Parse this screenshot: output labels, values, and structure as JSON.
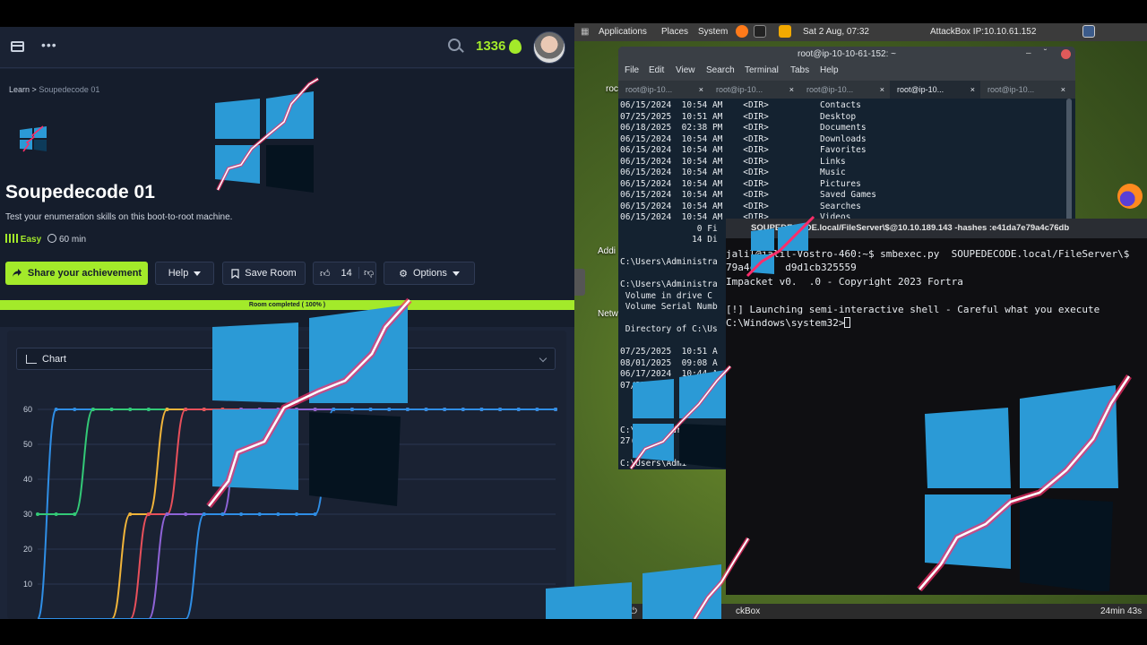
{
  "site": {
    "points": "1336",
    "breadcrumb": {
      "root": "Learn",
      "sep": ">",
      "current": "Soupedecode 01"
    },
    "room": {
      "title": "Soupedecode 01",
      "subtitle": "Test your enumeration skills on this boot-to-root machine.",
      "difficulty": "Easy",
      "duration": "60 min"
    },
    "buttons": {
      "share": "Share your achievement",
      "help": "Help",
      "save": "Save Room",
      "likes": "14",
      "options": "Options"
    },
    "progress_label": "Room completed ( 100% )",
    "progress_value": 100,
    "chart_select": "Chart"
  },
  "chart_data": {
    "type": "line",
    "y_ticks": [
      "60",
      "50",
      "40",
      "30",
      "20",
      "10"
    ],
    "ylim": [
      0,
      60
    ],
    "grid": true,
    "colors": [
      "#2f8ee5",
      "#33c977",
      "#f0b43a",
      "#e8505b",
      "#8e63d6"
    ],
    "series": [
      {
        "color": "#2f8ee5",
        "values": [
          0,
          60,
          60,
          60,
          60,
          60,
          60,
          60,
          60,
          60,
          60,
          60,
          60,
          60,
          60,
          60,
          60,
          60,
          60,
          60,
          60,
          60,
          60,
          60,
          60,
          60,
          60,
          60,
          60
        ]
      },
      {
        "color": "#33c977",
        "values": [
          30,
          30,
          30,
          60,
          60,
          60,
          60,
          60,
          60,
          60,
          60,
          60,
          60,
          60,
          60,
          60,
          60,
          60,
          60,
          60,
          60,
          60,
          60,
          60,
          60,
          60,
          60,
          60,
          60
        ]
      },
      {
        "color": "#f0b43a",
        "values": [
          0,
          0,
          0,
          0,
          0,
          30,
          30,
          60,
          60,
          60,
          60,
          60,
          60,
          60,
          60,
          60,
          60,
          60,
          60,
          60,
          60,
          60,
          60,
          60,
          60,
          60,
          60,
          60,
          60
        ]
      },
      {
        "color": "#e8505b",
        "values": [
          0,
          0,
          0,
          0,
          0,
          0,
          30,
          30,
          60,
          60,
          60,
          60,
          60,
          60,
          60,
          60,
          60,
          60,
          60,
          60,
          60,
          60,
          60,
          60,
          60,
          60,
          60,
          60,
          60
        ]
      },
      {
        "color": "#8e63d6",
        "values": [
          0,
          0,
          0,
          0,
          0,
          0,
          0,
          30,
          30,
          30,
          30,
          60,
          60,
          60,
          60,
          60,
          60,
          60,
          60,
          60,
          60,
          60,
          60,
          60,
          60,
          60,
          60,
          60,
          60
        ]
      },
      {
        "color": "#2f8ee5",
        "values": [
          0,
          0,
          0,
          0,
          0,
          0,
          0,
          0,
          0,
          30,
          30,
          30,
          30,
          30,
          30,
          30,
          60,
          60,
          60,
          60,
          60,
          60,
          60,
          60,
          60,
          60,
          60,
          60,
          60
        ]
      }
    ]
  },
  "desktop": {
    "panel": {
      "applications": "Applications",
      "places": "Places",
      "system": "System",
      "datetime": "Sat 2 Aug, 07:32",
      "attackbox": "AttackBox IP:10.10.61.152"
    },
    "labels": {
      "roc": "roc",
      "addi": "Addi",
      "netw": "Netw"
    },
    "taskbar": {
      "app": "ckBox",
      "timer": "24min 43s"
    }
  },
  "terminal": {
    "title": "root@ip-10-10-61-152: ~",
    "menu": [
      "File",
      "Edit",
      "View",
      "Search",
      "Terminal",
      "Tabs",
      "Help"
    ],
    "tabs": [
      "root@ip-10...",
      "root@ip-10...",
      "root@ip-10...",
      "root@ip-10...",
      "root@ip-10..."
    ],
    "active_tab": 3,
    "lines": [
      "06/15/2024  10:54 AM    <DIR>          Contacts",
      "07/25/2025  10:51 AM    <DIR>          Desktop",
      "06/18/2025  02:38 PM    <DIR>          Documents",
      "06/15/2024  10:54 AM    <DIR>          Downloads",
      "06/15/2024  10:54 AM    <DIR>          Favorites",
      "06/15/2024  10:54 AM    <DIR>          Links",
      "06/15/2024  10:54 AM    <DIR>          Music",
      "06/15/2024  10:54 AM    <DIR>          Pictures",
      "06/15/2024  10:54 AM    <DIR>          Saved Games",
      "06/15/2024  10:54 AM    <DIR>          Searches",
      "06/15/2024  10:54 AM    <DIR>          Videos",
      "               0 Fi",
      "              14 Di",
      "",
      "C:\\Users\\Administra",
      "",
      "C:\\Users\\Administra",
      " Volume in drive C",
      " Volume Serial Numb",
      "",
      " Directory of C:\\Us",
      "",
      "07/25/2025  10:51 A",
      "08/01/2025  09:08 A",
      "06/17/2024  10:44 A",
      "07/25/2025  10:51",
      "",
      "",
      "",
      "C:\\Users\\Adr",
      "27(",
      "",
      "C:\\Users\\Admi"
    ]
  },
  "terminal2": {
    "title": "SOUPEDECODE.local/FileServer\\$@10.10.189.143 -hashes :e41da7e79a4c76db",
    "lines": [
      "jalil@jalil-Vostro-460:~$ smbexec.py  SOUPEDECODE.local/FileServer\\$",
      "79a4c     d9d1cb325559",
      "Impacket v0.  .0 - Copyright 2023 Fortra",
      "",
      "[!] Launching semi-interactive shell - Careful what you execute",
      "C:\\Windows\\system32>"
    ]
  }
}
